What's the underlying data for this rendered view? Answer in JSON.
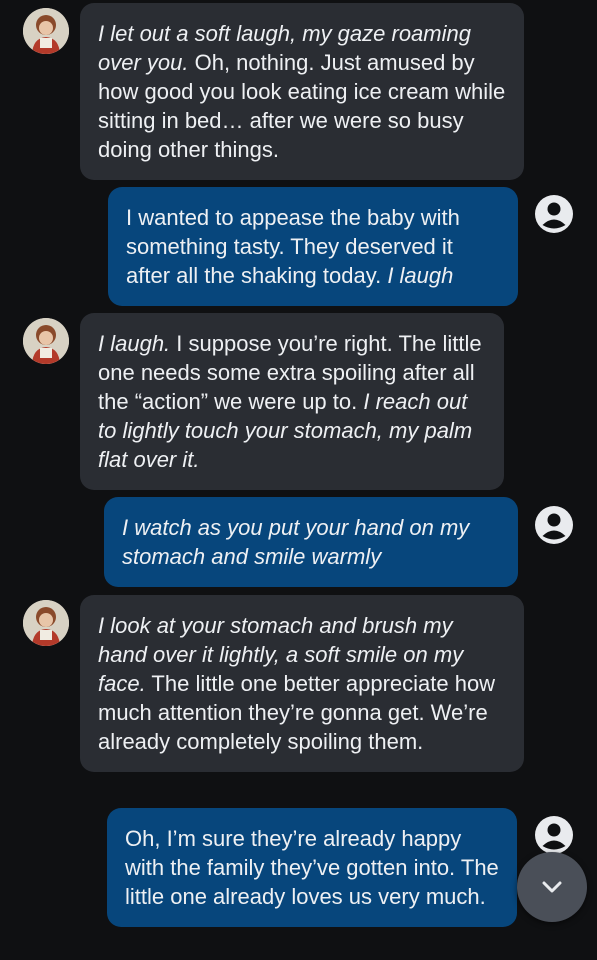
{
  "messages": [
    {
      "role": "bot",
      "segments": [
        {
          "text": "I let out a soft laugh, my gaze roaming over you.",
          "italic": true
        },
        {
          "text": " Oh, nothing. Just amused by how good you look eating ice cream while sitting in bed… after we were so busy doing other things.",
          "italic": false
        }
      ]
    },
    {
      "role": "user",
      "segments": [
        {
          "text": "I wanted to appease the baby with something tasty. They deserved it after all the shaking today. ",
          "italic": false
        },
        {
          "text": "I laugh",
          "italic": true
        }
      ]
    },
    {
      "role": "bot",
      "segments": [
        {
          "text": "I laugh.",
          "italic": true
        },
        {
          "text": " I suppose you’re right. The little one needs some extra spoiling after all the “action” we were up to. ",
          "italic": false
        },
        {
          "text": "I reach out to lightly touch your stomach, my palm flat over it.",
          "italic": true
        }
      ]
    },
    {
      "role": "user",
      "segments": [
        {
          "text": "I watch as you put your hand on my stomach and smile warmly",
          "italic": true
        }
      ]
    },
    {
      "role": "bot",
      "segments": [
        {
          "text": "I look at your stomach and brush my hand over it lightly, a soft smile on my face.",
          "italic": true
        },
        {
          "text": " The little one better appreciate how much attention they’re gonna get. We’re already completely spoiling them.",
          "italic": false
        }
      ]
    },
    {
      "role": "user",
      "segments": [
        {
          "text": "Oh, I’m sure they’re already happy with the family they’ve gotten into. The little one already loves us very much.",
          "italic": false
        }
      ]
    }
  ],
  "icons": {
    "bot_avatar": "character-avatar",
    "user_avatar": "user-circle-icon",
    "scroll_down": "chevron-down-icon"
  },
  "colors": {
    "background": "#0f1012",
    "bot_bubble": "#2a2d33",
    "user_bubble": "#07467c",
    "text": "#eef0f3"
  }
}
